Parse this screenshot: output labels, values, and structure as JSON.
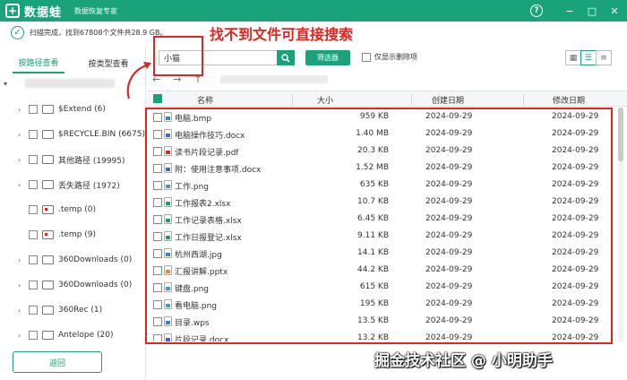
{
  "app": {
    "logo_mark": "+",
    "name": "数据蛙",
    "subtitle": "数据恢复专家"
  },
  "window_controls": {
    "help": "?",
    "minimize": "−",
    "maximize": "□",
    "close": "✕"
  },
  "status": {
    "text": "扫描完成，找到67808个文件共28.9 GB。"
  },
  "annotation": {
    "title": "找不到文件可直接搜索"
  },
  "sidebar": {
    "tabs": [
      {
        "label": "按路径查看",
        "active": true
      },
      {
        "label": "按类型查看",
        "active": false
      }
    ],
    "items": [
      {
        "label": "$Extend (6)",
        "icon": "folder"
      },
      {
        "label": "$RECYCLE.BIN (6675)",
        "icon": "folder"
      },
      {
        "label": "其他路径 (19995)",
        "icon": "folder"
      },
      {
        "label": "丢失路径 (1972)",
        "icon": "folder"
      },
      {
        "label": ".temp (0)",
        "icon": "folder-red"
      },
      {
        "label": ".temp (9)",
        "icon": "folder-red"
      },
      {
        "label": "360Downloads (0)",
        "icon": "folder"
      },
      {
        "label": "360Downloads (0)",
        "icon": "folder"
      },
      {
        "label": "360Rec (1)",
        "icon": "folder"
      },
      {
        "label": "Antelope (20)",
        "icon": "folder"
      }
    ],
    "back_label": "返回"
  },
  "toolbar": {
    "search_value": "小猫",
    "filter_label": "筛选器",
    "only_deleted_label": "仅显示删除项"
  },
  "table": {
    "headers": {
      "name": "名称",
      "size": "大小",
      "created": "创建日期",
      "modified": "修改日期"
    },
    "rows": [
      {
        "name": "电脑.bmp",
        "size": "959 KB",
        "created": "2024-09-29",
        "modified": "2024-09-29",
        "color": "#2f86d3"
      },
      {
        "name": "电脑操作技巧.docx",
        "size": "1.40 MB",
        "created": "2024-09-29",
        "modified": "2024-09-29",
        "color": "#2f6fd3"
      },
      {
        "name": "读书片段记录.pdf",
        "size": "20.3 KB",
        "created": "2024-09-29",
        "modified": "2024-09-29",
        "color": "#e5231f"
      },
      {
        "name": "附：使用注意事项.docx",
        "size": "1.52 MB",
        "created": "2024-09-29",
        "modified": "2024-09-29",
        "color": "#2f6fd3"
      },
      {
        "name": "工作.png",
        "size": "635 KB",
        "created": "2024-09-29",
        "modified": "2024-09-29",
        "color": "#3aa0c8"
      },
      {
        "name": "工作报表2.xlsx",
        "size": "10.7 KB",
        "created": "2024-09-29",
        "modified": "2024-09-29",
        "color": "#1aa35a"
      },
      {
        "name": "工作记录表格.xlsx",
        "size": "6.45 KB",
        "created": "2024-09-29",
        "modified": "2024-09-29",
        "color": "#1aa35a"
      },
      {
        "name": "工作日报登记.xlsx",
        "size": "9.11 KB",
        "created": "2024-09-29",
        "modified": "2024-09-29",
        "color": "#1aa35a"
      },
      {
        "name": "杭州西湖.jpg",
        "size": "14.1 KB",
        "created": "2024-09-29",
        "modified": "2024-09-29",
        "color": "#2f86d3"
      },
      {
        "name": "汇报讲解.pptx",
        "size": "44.2 KB",
        "created": "2024-09-29",
        "modified": "2024-09-29",
        "color": "#f08a1c"
      },
      {
        "name": "键盘.png",
        "size": "615 KB",
        "created": "2024-09-29",
        "modified": "2024-09-29",
        "color": "#3aa0c8"
      },
      {
        "name": "看电脑.png",
        "size": "195 KB",
        "created": "2024-09-29",
        "modified": "2024-09-29",
        "color": "#3aa0c8"
      },
      {
        "name": "目录.wps",
        "size": "13.5 KB",
        "created": "2024-09-29",
        "modified": "2024-09-29",
        "color": "#2f86d3"
      },
      {
        "name": "片段记录.docx",
        "size": "13.2 KB",
        "created": "2024-09-29",
        "modified": "2024-09-29",
        "color": "#2f6fd3"
      }
    ]
  },
  "watermark": "掘金技术社区 @ 小明助手"
}
